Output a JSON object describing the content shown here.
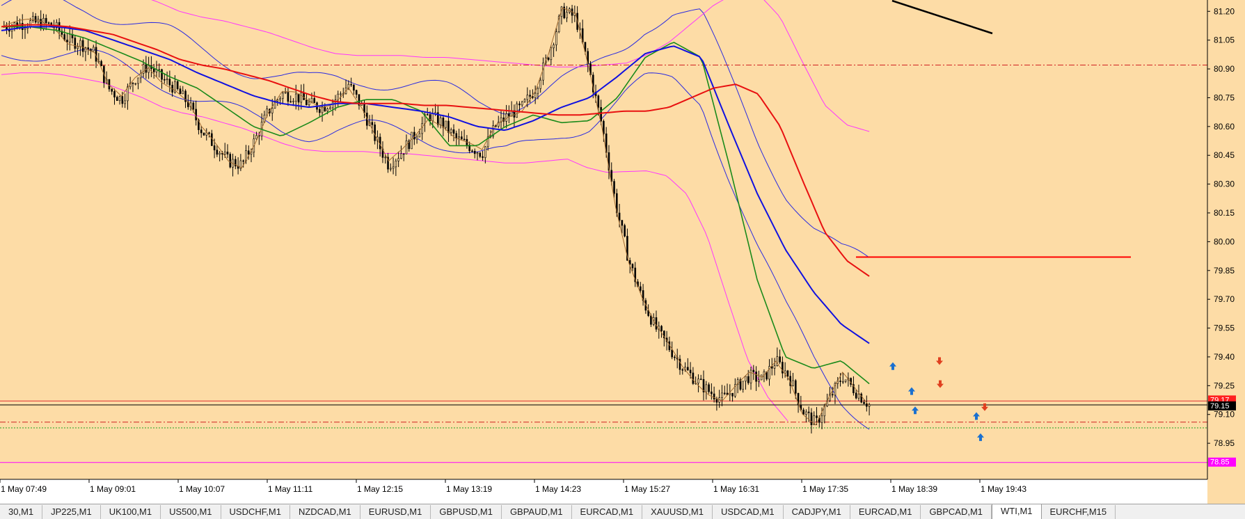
{
  "chart_data": {
    "type": "candlestick",
    "symbol": "WTI,M1",
    "background": "#FDDCA6",
    "y_ticks": [
      "81.20",
      "81.05",
      "80.90",
      "80.75",
      "80.60",
      "80.45",
      "80.30",
      "80.15",
      "80.00",
      "79.85",
      "79.70",
      "79.55",
      "79.40",
      "79.25",
      "79.10",
      "78.95"
    ],
    "y_tick_values": [
      81.2,
      81.05,
      80.9,
      80.75,
      80.6,
      80.45,
      80.3,
      80.15,
      80.0,
      79.85,
      79.7,
      79.55,
      79.4,
      79.25,
      79.1,
      78.95
    ],
    "ylim": [
      78.82,
      81.23
    ],
    "x_ticks": [
      "1 May 07:49",
      "1 May 09:01",
      "1 May 10:07",
      "1 May 11:11",
      "1 May 12:15",
      "1 May 13:19",
      "1 May 14:23",
      "1 May 15:27",
      "1 May 16:31",
      "1 May 17:35",
      "1 May 18:39",
      "1 May 19:43"
    ],
    "price_labels": {
      "current_price": "79.15",
      "current_price_color": "#000000",
      "bid_label": "79.17",
      "lower_band_label": "78.85",
      "lower_band_color": "#FF00FF"
    },
    "horizontal_levels": [
      {
        "value": 80.92,
        "style": "dashdot",
        "color": "#D02020"
      },
      {
        "value": 79.17,
        "style": "solid",
        "color": "#E03030"
      },
      {
        "value": 79.15,
        "style": "solid",
        "color": "#000000"
      },
      {
        "value": 79.06,
        "style": "dashdot",
        "color": "#D02020"
      },
      {
        "value": 79.03,
        "style": "dotted",
        "color": "#20A020"
      },
      {
        "value": 78.85,
        "style": "solid",
        "color": "#FF00FF"
      }
    ],
    "colors": {
      "candles": "#000000",
      "ma_red": "#E81010",
      "ma_blue": "#1010E0",
      "ma_green": "#1A8A1A",
      "ma_brown": "#A06A30",
      "bands_blue": "#2A2AE0",
      "bands_magenta": "#FF33FF",
      "trendline": "#000000",
      "level_line": "#FF0000",
      "buy_arrow": "#1A70D0",
      "sell_arrow": "#E04020"
    },
    "series": [
      {
        "kind": "price_close",
        "values": [
          81.12,
          81.13,
          81.14,
          81.14,
          81.12,
          81.05,
          81.03,
          80.98,
          80.8,
          80.74,
          80.85,
          80.92,
          80.85,
          80.8,
          80.72,
          80.58,
          80.5,
          80.42,
          80.4,
          80.53,
          80.68,
          80.77,
          80.76,
          80.72,
          80.7,
          80.74,
          80.82,
          80.7,
          80.54,
          80.4,
          80.47,
          80.56,
          80.66,
          80.62,
          80.54,
          80.5,
          80.46,
          80.6,
          80.66,
          80.7,
          80.8,
          80.98,
          81.2,
          81.17,
          80.9,
          80.6,
          80.2,
          79.9,
          79.7,
          79.55,
          79.45,
          79.35,
          79.28,
          79.22,
          79.18,
          79.24,
          79.3,
          79.28,
          79.38,
          79.3,
          79.12,
          79.05,
          79.18,
          79.3,
          79.22,
          79.15
        ]
      },
      {
        "kind": "ma_red",
        "values": [
          81.12,
          81.13,
          81.13,
          81.12,
          81.1,
          81.08,
          81.04,
          81.0,
          80.95,
          80.92,
          80.9,
          80.87,
          80.84,
          80.8,
          80.76,
          80.73,
          80.72,
          80.72,
          80.72,
          80.71,
          80.71,
          80.7,
          80.69,
          80.68,
          80.67,
          80.66,
          80.66,
          80.67,
          80.68,
          80.68,
          80.7,
          80.75,
          80.8,
          80.82,
          80.77,
          80.6,
          80.32,
          80.05,
          79.9,
          79.82
        ]
      },
      {
        "kind": "ma_blue",
        "values": [
          81.1,
          81.12,
          81.12,
          81.1,
          81.05,
          81.0,
          80.95,
          80.88,
          80.82,
          80.76,
          80.72,
          80.7,
          80.72,
          80.72,
          80.7,
          80.68,
          80.65,
          80.6,
          80.58,
          80.63,
          80.7,
          80.75,
          80.86,
          80.98,
          81.02,
          80.96,
          80.6,
          80.25,
          79.96,
          79.74,
          79.57,
          79.47
        ]
      },
      {
        "kind": "ma_green",
        "values": [
          81.12,
          81.12,
          81.1,
          81.06,
          81.0,
          80.94,
          80.86,
          80.8,
          80.7,
          80.6,
          80.55,
          80.62,
          80.7,
          80.74,
          80.74,
          80.68,
          80.5,
          80.5,
          80.6,
          80.66,
          80.62,
          80.63,
          80.75,
          80.96,
          81.04,
          80.96,
          80.4,
          79.8,
          79.4,
          79.34,
          79.38,
          79.26
        ]
      }
    ],
    "arrows": [
      {
        "type": "buy",
        "x": "1 May 18:39",
        "price": 79.35
      },
      {
        "type": "buy",
        "x": "1 May 18:39",
        "price": 79.22
      },
      {
        "type": "buy",
        "x": "1 May 18:39",
        "price": 79.12
      },
      {
        "type": "sell",
        "x": "1 May 18:39",
        "price": 79.38
      },
      {
        "type": "sell",
        "x": "1 May 18:39",
        "price": 79.26
      },
      {
        "type": "buy",
        "x": "1 May 19:43",
        "price": 79.09
      },
      {
        "type": "buy",
        "x": "1 May 19:43",
        "price": 78.98
      },
      {
        "type": "sell",
        "x": "1 May 19:43",
        "price": 79.14
      }
    ]
  },
  "tabs": [
    "30,M1",
    "JP225,M1",
    "UK100,M1",
    "US500,M1",
    "USDCHF,M1",
    "NZDCAD,M1",
    "EURUSD,M1",
    "GBPUSD,M1",
    "GBPAUD,M1",
    "EURCAD,M1",
    "XAUUSD,M1",
    "USDCAD,M1",
    "CADJPY,M1",
    "EURCAD,M1",
    "GBPCAD,M1",
    "WTI,M1",
    "EURCHF,M15"
  ],
  "active_tab": "WTI,M1"
}
